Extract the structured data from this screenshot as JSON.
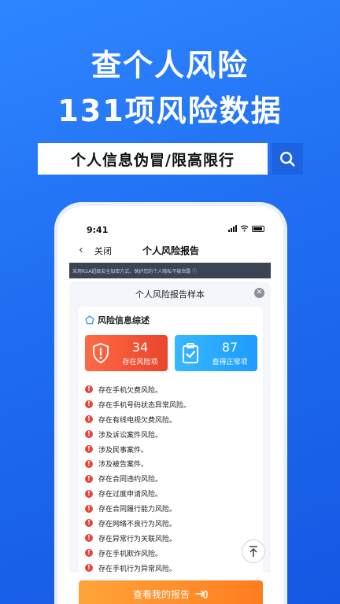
{
  "hero": {
    "line1": "查个人风险",
    "line2": "131项风险数据"
  },
  "search": {
    "query": "个人信息伪冒/限高限行",
    "button_icon": "search-icon"
  },
  "phone": {
    "status_time": "9:41",
    "nav": {
      "back_icon": "chevron-left-icon",
      "close_label": "关闭",
      "title": "个人风险报告"
    },
    "notice": "采用RSA超级安全加密方式，保护您的个人隐私不被泄露 ⓘ",
    "card": {
      "title": "个人风险报告样本",
      "section_title": "风险信息综述",
      "stats": [
        {
          "value": "34",
          "label": "存在风险项"
        },
        {
          "value": "87",
          "label": "查得正常项"
        }
      ],
      "risks": [
        "存在手机欠费风险。",
        "存在手机号码状态异常风险。",
        "存在有线电视欠费风险。",
        "涉及诉讼案件风险。",
        "涉及民事案件。",
        "涉及被告案件。",
        "存在合同违约风险。",
        "存在过度申请风险。",
        "存在合同履行能力风险。",
        "存在网络不良行为风险。",
        "存在异常行为关联风险。",
        "存在手机欺诈风险。",
        "存在手机行为异常风险。"
      ]
    },
    "cta_label": "查看我的报告"
  },
  "colors": {
    "background": "#1f6df2",
    "risk_red": "#e4453a",
    "stat_blue": "#1e9bff",
    "cta_orange": "#ff7d1f"
  }
}
